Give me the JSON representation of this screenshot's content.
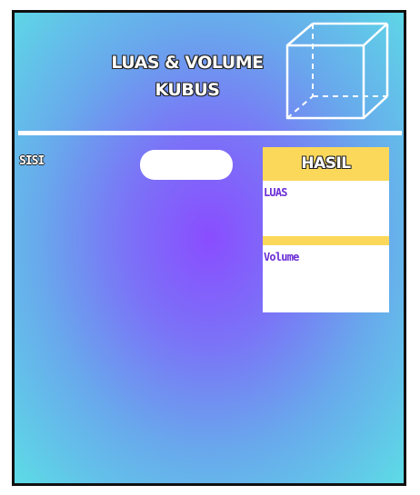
{
  "header": {
    "title_line1": "LUAS & VOLUME",
    "title_line2": "KUBUS",
    "illustration_icon": "cube-outline-icon"
  },
  "form": {
    "side_label": "SISI",
    "side_value": ""
  },
  "result": {
    "header_label": "HASIL",
    "area_label": "LUAS",
    "area_value": "",
    "volume_label": "Volume",
    "volume_value": ""
  },
  "colors": {
    "background_center": "#8a4dff",
    "background_edge": "#5ddbe6",
    "accent_yellow": "#fbd85a",
    "label_purple": "#6b2ed6",
    "frame_border": "#111111"
  }
}
